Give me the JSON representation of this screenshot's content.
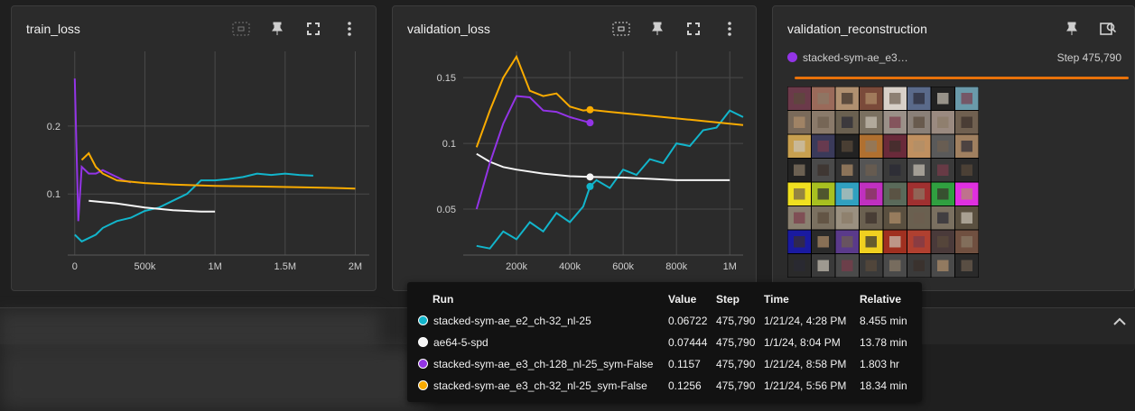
{
  "cards": {
    "train": {
      "title": "train_loss"
    },
    "val": {
      "title": "validation_loss"
    },
    "recon": {
      "title": "validation_reconstruction",
      "run_name": "stacked-sym-ae_e3…",
      "step_text": "Step 475,790",
      "run_color": "#9334e6",
      "slider_fraction": 1.0
    }
  },
  "icons": {
    "fit": "fit-domain-icon",
    "pin": "pin-icon",
    "fullscreen": "fullscreen-icon",
    "more": "more-vert-icon",
    "image_search": "image-search-icon",
    "collapse": "chevron-up-icon"
  },
  "tooltip": {
    "headers": [
      "Run",
      "Value",
      "Step",
      "Time",
      "Relative"
    ],
    "rows": [
      {
        "run": "stacked-sym-ae_e2_ch-32_nl-25",
        "value": "0.06722",
        "step": "475,790",
        "time": "1/21/24, 4:28 PM",
        "relative": "8.455 min",
        "color": "#12b5cb"
      },
      {
        "run": "ae64-5-spd",
        "value": "0.07444",
        "step": "475,790",
        "time": "1/1/24, 8:04 PM",
        "relative": "13.78 min",
        "color": "#f5f5f5"
      },
      {
        "run": "stacked-sym-ae_e3_ch-128_nl-25_sym-False",
        "value": "0.1157",
        "step": "475,790",
        "time": "1/21/24, 8:58 PM",
        "relative": "1.803 hr",
        "color": "#9334e6"
      },
      {
        "run": "stacked-sym-ae_e3_ch-32_nl-25_sym-False",
        "value": "0.1256",
        "step": "475,790",
        "time": "1/21/24, 5:56 PM",
        "relative": "18.34 min",
        "color": "#f9ab00"
      }
    ]
  },
  "chart_data": [
    {
      "type": "line",
      "title": "train_loss",
      "y_ticks": [
        "0.1",
        "0.2"
      ],
      "x_ticks": [
        "0",
        "500k",
        "1M",
        "1.5M",
        "2M"
      ],
      "xlim": [
        -50000,
        2100000
      ],
      "ylim": [
        0.01,
        0.31
      ],
      "grid": true,
      "series": [
        {
          "name": "stacked-sym-ae_e2_ch-32_nl-25",
          "color": "#12b5cb",
          "x": [
            0,
            50000,
            100000,
            150000,
            200000,
            300000,
            400000,
            500000,
            600000,
            700000,
            800000,
            900000,
            1000000,
            1100000,
            1200000,
            1300000,
            1400000,
            1500000,
            1600000,
            1700000
          ],
          "y": [
            0.04,
            0.03,
            0.035,
            0.04,
            0.05,
            0.06,
            0.065,
            0.075,
            0.08,
            0.09,
            0.1,
            0.12,
            0.12,
            0.122,
            0.125,
            0.13,
            0.128,
            0.13,
            0.128,
            0.127
          ]
        },
        {
          "name": "ae64-5-spd",
          "color": "#f5f5f5",
          "x": [
            100000,
            200000,
            300000,
            400000,
            500000,
            600000,
            700000,
            800000,
            900000,
            1000000
          ],
          "y": [
            0.09,
            0.088,
            0.086,
            0.083,
            0.08,
            0.078,
            0.076,
            0.075,
            0.074,
            0.074
          ]
        },
        {
          "name": "stacked-sym-ae_e3_ch-128_nl-25_sym-False",
          "color": "#9334e6",
          "x": [
            0,
            25000,
            50000,
            100000,
            150000,
            200000,
            250000,
            300000,
            350000,
            400000
          ],
          "y": [
            0.27,
            0.06,
            0.14,
            0.13,
            0.13,
            0.135,
            0.13,
            0.125,
            0.12,
            0.117
          ]
        },
        {
          "name": "stacked-sym-ae_e3_ch-32_nl-25_sym-False",
          "color": "#f9ab00",
          "x": [
            50000,
            100000,
            150000,
            200000,
            300000,
            500000,
            700000,
            1000000,
            1300000,
            1600000,
            1800000,
            2000000
          ],
          "y": [
            0.15,
            0.16,
            0.14,
            0.13,
            0.12,
            0.116,
            0.114,
            0.112,
            0.111,
            0.11,
            0.109,
            0.108
          ]
        }
      ]
    },
    {
      "type": "line",
      "title": "validation_loss",
      "y_ticks": [
        "0.05",
        "0.1",
        "0.15"
      ],
      "x_ticks": [
        "200k",
        "400k",
        "600k",
        "800k",
        "1M"
      ],
      "xlim": [
        0,
        1050000
      ],
      "ylim": [
        0.015,
        0.17
      ],
      "grid": true,
      "series": [
        {
          "name": "stacked-sym-ae_e2_ch-32_nl-25",
          "color": "#12b5cb",
          "x": [
            50000,
            100000,
            150000,
            200000,
            250000,
            300000,
            350000,
            400000,
            450000,
            475790,
            500000,
            550000,
            600000,
            650000,
            700000,
            750000,
            800000,
            850000,
            900000,
            950000,
            1000000,
            1050000
          ],
          "y": [
            0.022,
            0.02,
            0.033,
            0.027,
            0.04,
            0.033,
            0.047,
            0.04,
            0.052,
            0.06722,
            0.072,
            0.066,
            0.08,
            0.076,
            0.088,
            0.085,
            0.1,
            0.098,
            0.11,
            0.112,
            0.125,
            0.12
          ]
        },
        {
          "name": "ae64-5-spd",
          "color": "#f5f5f5",
          "x": [
            50000,
            100000,
            150000,
            200000,
            300000,
            400000,
            475790,
            600000,
            700000,
            800000,
            900000,
            1000000
          ],
          "y": [
            0.092,
            0.086,
            0.082,
            0.08,
            0.077,
            0.075,
            0.07444,
            0.074,
            0.073,
            0.072,
            0.072,
            0.072
          ]
        },
        {
          "name": "stacked-sym-ae_e3_ch-128_nl-25_sym-False",
          "color": "#9334e6",
          "x": [
            50000,
            100000,
            150000,
            200000,
            250000,
            300000,
            350000,
            400000,
            475790
          ],
          "y": [
            0.05,
            0.085,
            0.115,
            0.136,
            0.135,
            0.125,
            0.124,
            0.12,
            0.1157
          ]
        },
        {
          "name": "stacked-sym-ae_e3_ch-32_nl-25_sym-False",
          "color": "#f9ab00",
          "x": [
            50000,
            100000,
            150000,
            200000,
            250000,
            300000,
            350000,
            400000,
            450000,
            475790,
            550000,
            650000,
            750000,
            850000,
            950000,
            1050000
          ],
          "y": [
            0.097,
            0.125,
            0.15,
            0.166,
            0.14,
            0.136,
            0.138,
            0.128,
            0.125,
            0.1256,
            0.124,
            0.122,
            0.12,
            0.118,
            0.116,
            0.114
          ]
        }
      ]
    }
  ]
}
